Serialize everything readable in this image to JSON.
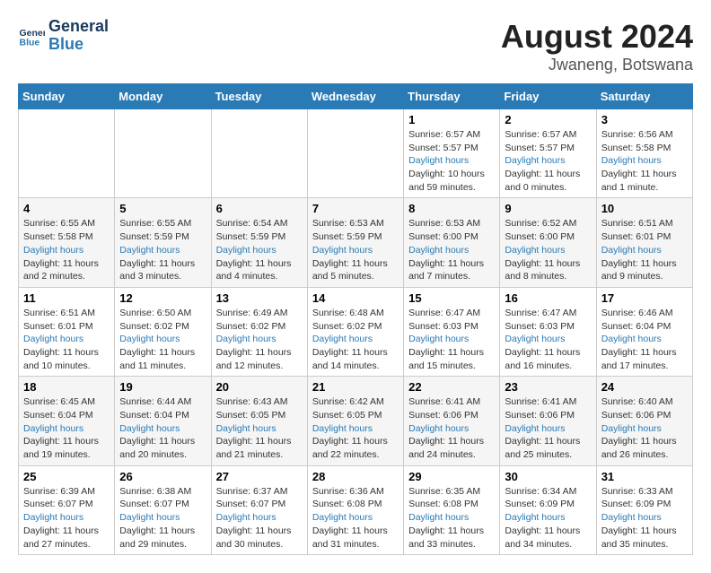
{
  "header": {
    "logo_line1": "General",
    "logo_line2": "Blue",
    "title": "August 2024",
    "subtitle": "Jwaneng, Botswana"
  },
  "calendar": {
    "weekdays": [
      "Sunday",
      "Monday",
      "Tuesday",
      "Wednesday",
      "Thursday",
      "Friday",
      "Saturday"
    ],
    "weeks": [
      [
        {
          "day": "",
          "sunrise": "",
          "sunset": "",
          "daylight": ""
        },
        {
          "day": "",
          "sunrise": "",
          "sunset": "",
          "daylight": ""
        },
        {
          "day": "",
          "sunrise": "",
          "sunset": "",
          "daylight": ""
        },
        {
          "day": "",
          "sunrise": "",
          "sunset": "",
          "daylight": ""
        },
        {
          "day": "1",
          "sunrise": "Sunrise: 6:57 AM",
          "sunset": "Sunset: 5:57 PM",
          "daylight": "Daylight: 10 hours and 59 minutes."
        },
        {
          "day": "2",
          "sunrise": "Sunrise: 6:57 AM",
          "sunset": "Sunset: 5:57 PM",
          "daylight": "Daylight: 11 hours and 0 minutes."
        },
        {
          "day": "3",
          "sunrise": "Sunrise: 6:56 AM",
          "sunset": "Sunset: 5:58 PM",
          "daylight": "Daylight: 11 hours and 1 minute."
        }
      ],
      [
        {
          "day": "4",
          "sunrise": "Sunrise: 6:55 AM",
          "sunset": "Sunset: 5:58 PM",
          "daylight": "Daylight: 11 hours and 2 minutes."
        },
        {
          "day": "5",
          "sunrise": "Sunrise: 6:55 AM",
          "sunset": "Sunset: 5:59 PM",
          "daylight": "Daylight: 11 hours and 3 minutes."
        },
        {
          "day": "6",
          "sunrise": "Sunrise: 6:54 AM",
          "sunset": "Sunset: 5:59 PM",
          "daylight": "Daylight: 11 hours and 4 minutes."
        },
        {
          "day": "7",
          "sunrise": "Sunrise: 6:53 AM",
          "sunset": "Sunset: 5:59 PM",
          "daylight": "Daylight: 11 hours and 5 minutes."
        },
        {
          "day": "8",
          "sunrise": "Sunrise: 6:53 AM",
          "sunset": "Sunset: 6:00 PM",
          "daylight": "Daylight: 11 hours and 7 minutes."
        },
        {
          "day": "9",
          "sunrise": "Sunrise: 6:52 AM",
          "sunset": "Sunset: 6:00 PM",
          "daylight": "Daylight: 11 hours and 8 minutes."
        },
        {
          "day": "10",
          "sunrise": "Sunrise: 6:51 AM",
          "sunset": "Sunset: 6:01 PM",
          "daylight": "Daylight: 11 hours and 9 minutes."
        }
      ],
      [
        {
          "day": "11",
          "sunrise": "Sunrise: 6:51 AM",
          "sunset": "Sunset: 6:01 PM",
          "daylight": "Daylight: 11 hours and 10 minutes."
        },
        {
          "day": "12",
          "sunrise": "Sunrise: 6:50 AM",
          "sunset": "Sunset: 6:02 PM",
          "daylight": "Daylight: 11 hours and 11 minutes."
        },
        {
          "day": "13",
          "sunrise": "Sunrise: 6:49 AM",
          "sunset": "Sunset: 6:02 PM",
          "daylight": "Daylight: 11 hours and 12 minutes."
        },
        {
          "day": "14",
          "sunrise": "Sunrise: 6:48 AM",
          "sunset": "Sunset: 6:02 PM",
          "daylight": "Daylight: 11 hours and 14 minutes."
        },
        {
          "day": "15",
          "sunrise": "Sunrise: 6:47 AM",
          "sunset": "Sunset: 6:03 PM",
          "daylight": "Daylight: 11 hours and 15 minutes."
        },
        {
          "day": "16",
          "sunrise": "Sunrise: 6:47 AM",
          "sunset": "Sunset: 6:03 PM",
          "daylight": "Daylight: 11 hours and 16 minutes."
        },
        {
          "day": "17",
          "sunrise": "Sunrise: 6:46 AM",
          "sunset": "Sunset: 6:04 PM",
          "daylight": "Daylight: 11 hours and 17 minutes."
        }
      ],
      [
        {
          "day": "18",
          "sunrise": "Sunrise: 6:45 AM",
          "sunset": "Sunset: 6:04 PM",
          "daylight": "Daylight: 11 hours and 19 minutes."
        },
        {
          "day": "19",
          "sunrise": "Sunrise: 6:44 AM",
          "sunset": "Sunset: 6:04 PM",
          "daylight": "Daylight: 11 hours and 20 minutes."
        },
        {
          "day": "20",
          "sunrise": "Sunrise: 6:43 AM",
          "sunset": "Sunset: 6:05 PM",
          "daylight": "Daylight: 11 hours and 21 minutes."
        },
        {
          "day": "21",
          "sunrise": "Sunrise: 6:42 AM",
          "sunset": "Sunset: 6:05 PM",
          "daylight": "Daylight: 11 hours and 22 minutes."
        },
        {
          "day": "22",
          "sunrise": "Sunrise: 6:41 AM",
          "sunset": "Sunset: 6:06 PM",
          "daylight": "Daylight: 11 hours and 24 minutes."
        },
        {
          "day": "23",
          "sunrise": "Sunrise: 6:41 AM",
          "sunset": "Sunset: 6:06 PM",
          "daylight": "Daylight: 11 hours and 25 minutes."
        },
        {
          "day": "24",
          "sunrise": "Sunrise: 6:40 AM",
          "sunset": "Sunset: 6:06 PM",
          "daylight": "Daylight: 11 hours and 26 minutes."
        }
      ],
      [
        {
          "day": "25",
          "sunrise": "Sunrise: 6:39 AM",
          "sunset": "Sunset: 6:07 PM",
          "daylight": "Daylight: 11 hours and 27 minutes."
        },
        {
          "day": "26",
          "sunrise": "Sunrise: 6:38 AM",
          "sunset": "Sunset: 6:07 PM",
          "daylight": "Daylight: 11 hours and 29 minutes."
        },
        {
          "day": "27",
          "sunrise": "Sunrise: 6:37 AM",
          "sunset": "Sunset: 6:07 PM",
          "daylight": "Daylight: 11 hours and 30 minutes."
        },
        {
          "day": "28",
          "sunrise": "Sunrise: 6:36 AM",
          "sunset": "Sunset: 6:08 PM",
          "daylight": "Daylight: 11 hours and 31 minutes."
        },
        {
          "day": "29",
          "sunrise": "Sunrise: 6:35 AM",
          "sunset": "Sunset: 6:08 PM",
          "daylight": "Daylight: 11 hours and 33 minutes."
        },
        {
          "day": "30",
          "sunrise": "Sunrise: 6:34 AM",
          "sunset": "Sunset: 6:09 PM",
          "daylight": "Daylight: 11 hours and 34 minutes."
        },
        {
          "day": "31",
          "sunrise": "Sunrise: 6:33 AM",
          "sunset": "Sunset: 6:09 PM",
          "daylight": "Daylight: 11 hours and 35 minutes."
        }
      ]
    ]
  }
}
